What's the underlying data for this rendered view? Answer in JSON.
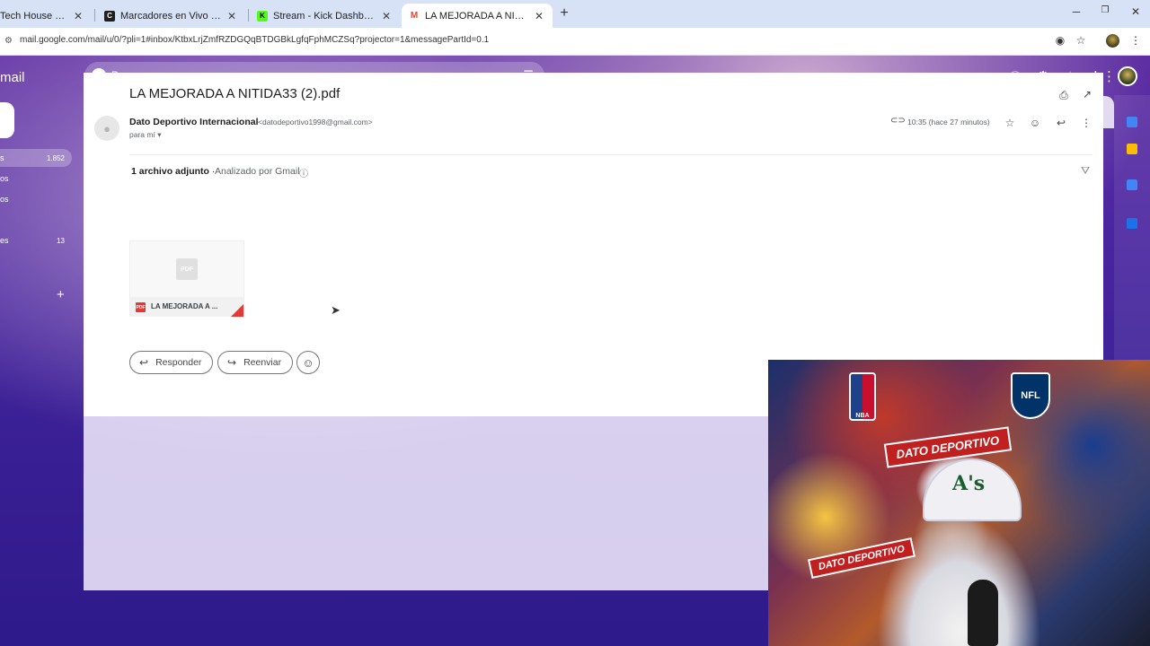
{
  "browser": {
    "tabs": [
      {
        "label": "Tech House Mix | Janu",
        "favicon_color": "#ffffff",
        "favicon_text": ""
      },
      {
        "label": "Marcadores en Vivo de Fútbol,",
        "favicon_color": "#1f1f1f",
        "favicon_text": "C"
      },
      {
        "label": "Stream - Kick Dashboard",
        "favicon_color": "#53fc18",
        "favicon_text": "K"
      },
      {
        "label": "LA MEJORADA A NITIDA33 (2).p",
        "favicon_color": "#ea4335",
        "favicon_text": "M"
      }
    ],
    "active_tab": 3,
    "url": "mail.google.com/mail/u/0/?pli=1#inbox/KtbxLrjZmfRZDGQqBTDGBkLgfqFphMCZSq?projector=1&messagePartId=0.1"
  },
  "gmail": {
    "brand": "mail",
    "search_placeholder": "Buscar correo",
    "nav": [
      {
        "label": "s",
        "count": "1.852",
        "selected": true
      },
      {
        "label": "os",
        "count": "",
        "selected": false
      },
      {
        "label": "os",
        "count": "",
        "selected": false
      },
      {
        "label": "es",
        "count": "13",
        "selected": false
      }
    ],
    "toolbar_lang": "Es"
  },
  "message": {
    "subject": "LA MEJORADA A NITIDA33 (2).pdf",
    "sender_name": "Dato Deportivo Internacional",
    "sender_email": "<datodeportivo1998@gmail.com>",
    "recipient": "para mí",
    "time": "10:35 (hace 27 minutos)",
    "attachments_count_label": "1 archivo adjunto",
    "attachments_scan": "Analizado por Gmail",
    "attachment": {
      "name": "LA MEJORADA A ...",
      "type_badge": "PDF",
      "thumb_label": "PDF"
    },
    "reply_label": "Responder",
    "forward_label": "Reenviar"
  },
  "webcam": {
    "banner_top": "DATO DEPORTIVO",
    "banner_bottom": "DATO DEPORTIVO",
    "nba": "NBA",
    "nfl": "NFL",
    "cap_logo": "A's"
  }
}
